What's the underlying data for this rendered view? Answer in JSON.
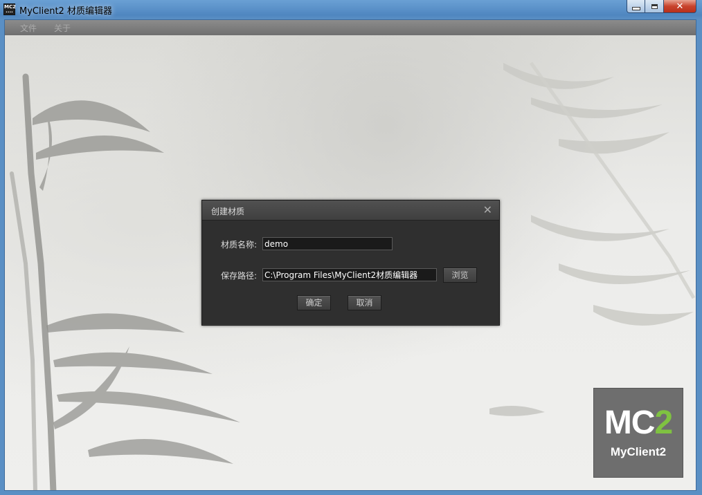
{
  "window": {
    "title": "MyClient2 材质编辑器",
    "icon_lines": [
      "MC2",
      "····"
    ],
    "controls": {
      "minimize": "minimize-icon",
      "maximize": "maximize-icon",
      "close": "✕"
    }
  },
  "menubar": {
    "items": [
      {
        "label": "文件"
      },
      {
        "label": "关于"
      }
    ]
  },
  "logo": {
    "mc": "MC",
    "two": "2",
    "subtitle": "MyClient2",
    "accent": "#7fc241"
  },
  "dialog": {
    "title": "创建材质",
    "close": "✕",
    "name_label": "材质名称:",
    "name_value": "demo",
    "path_label": "保存路径:",
    "path_value": "C:\\Program Files\\MyClient2材质编辑器",
    "browse_label": "浏览",
    "ok_label": "确定",
    "cancel_label": "取消"
  }
}
